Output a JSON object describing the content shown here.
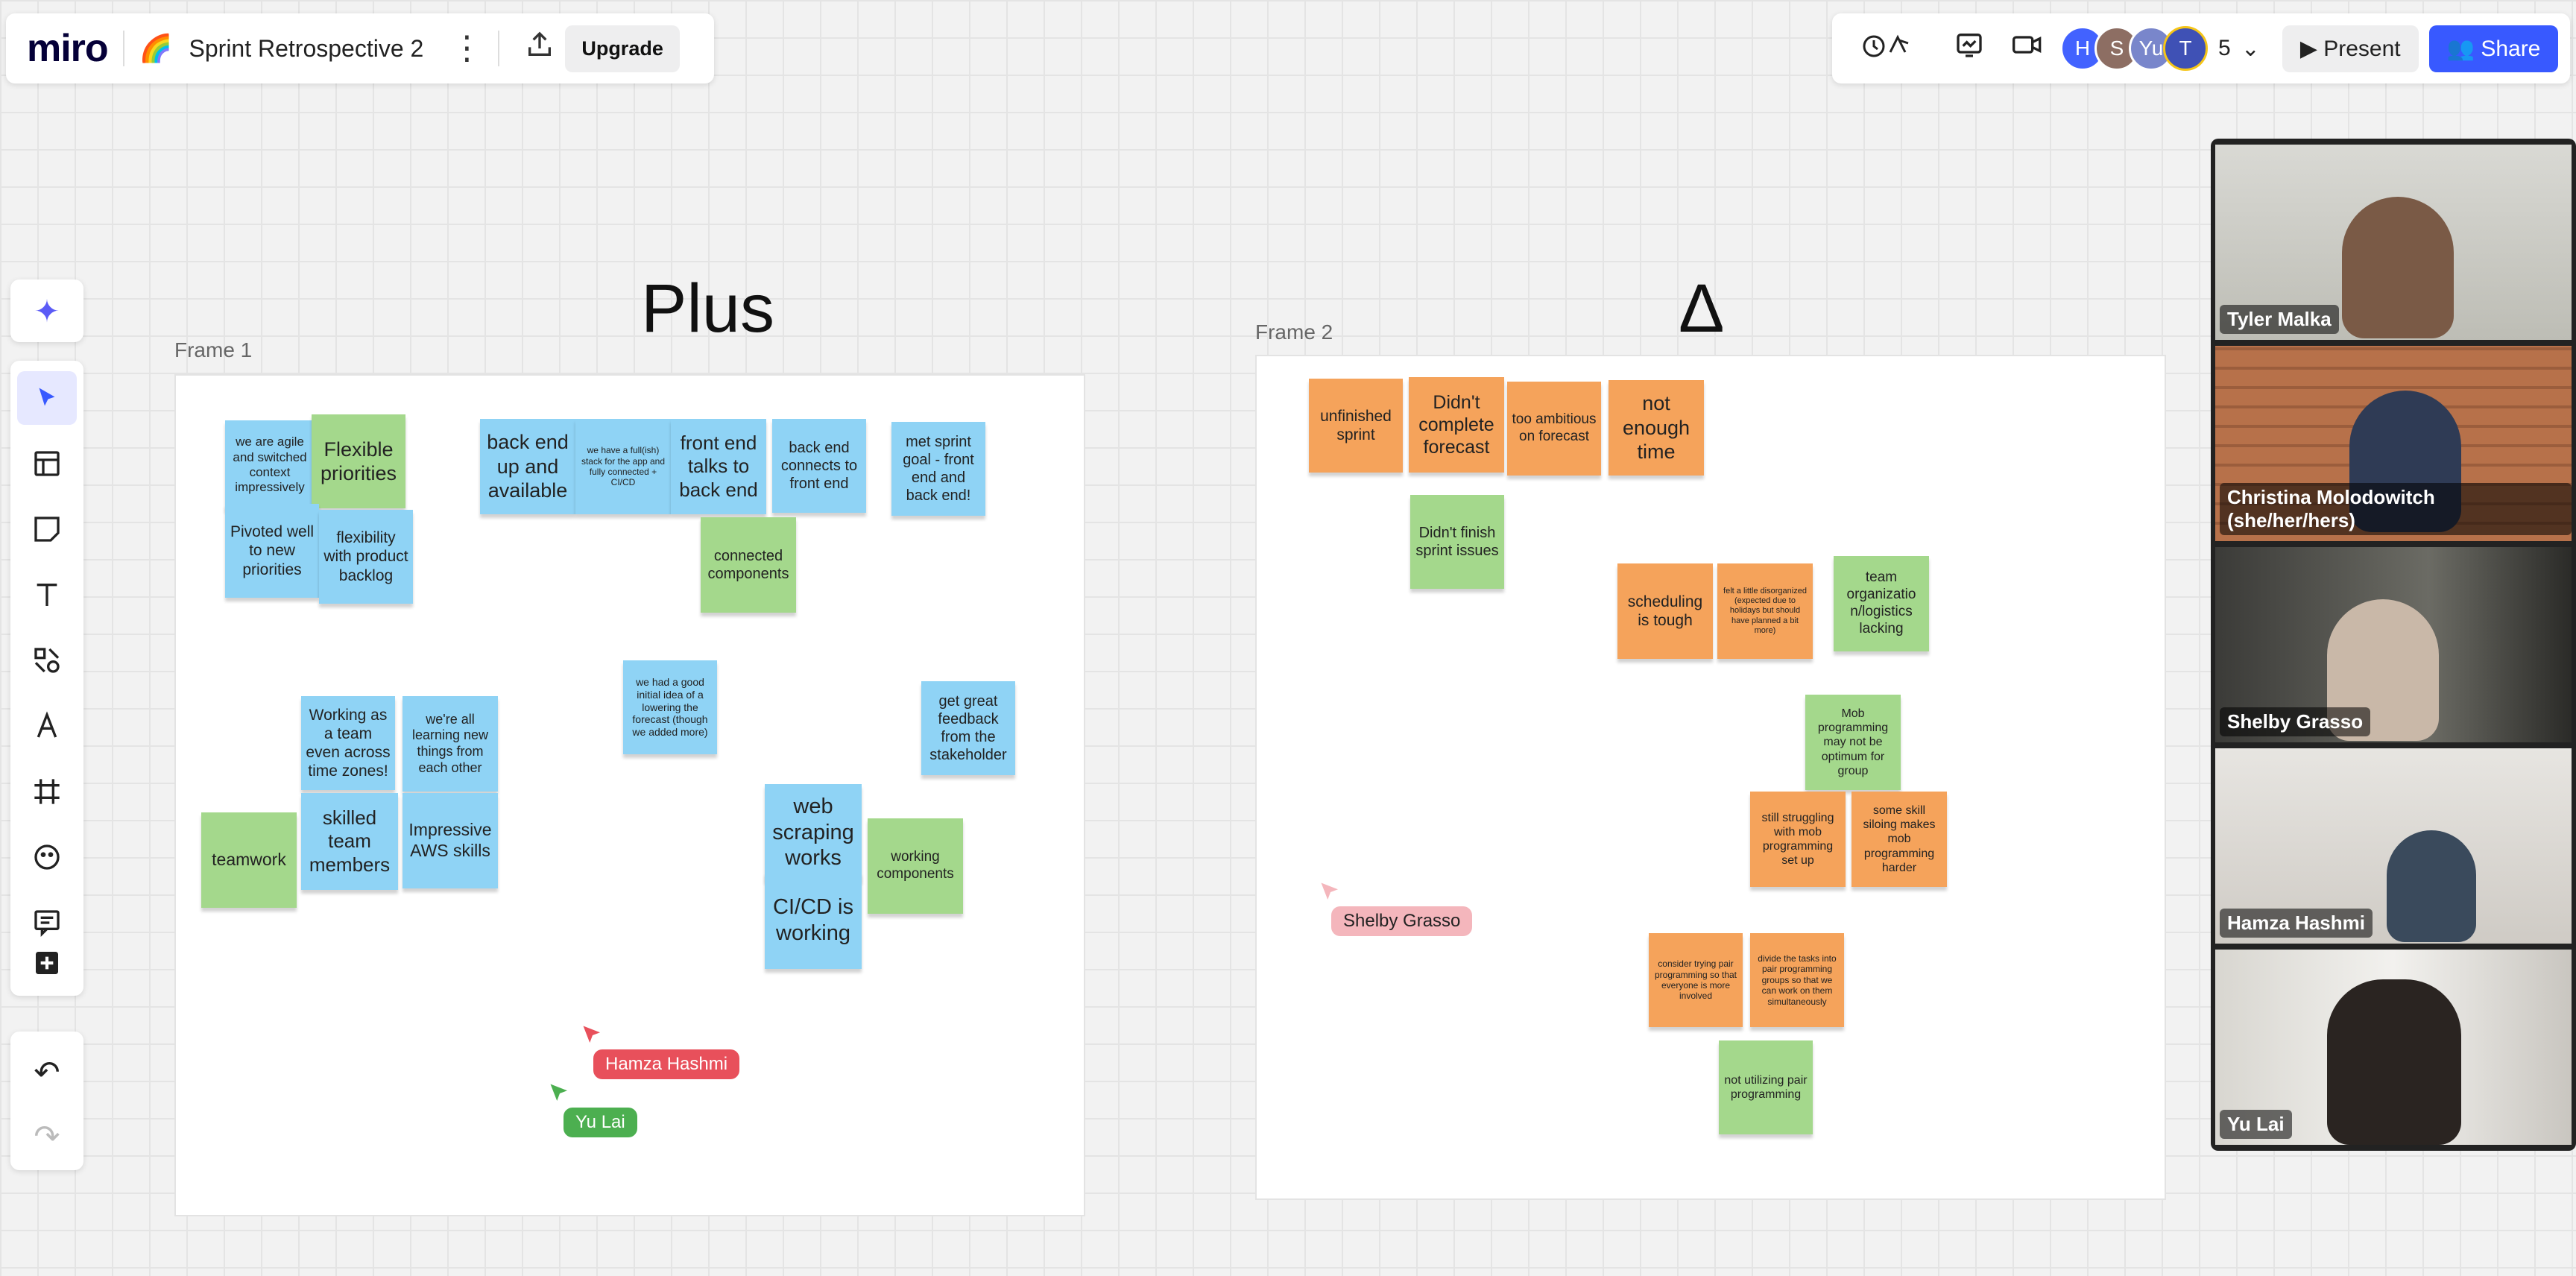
{
  "app": {
    "logo": "miro"
  },
  "board": {
    "emoji": "🌈",
    "title": "Sprint Retrospective 2",
    "menu_icon": "⋮",
    "upload_icon": "⇪",
    "upgrade_label": "Upgrade"
  },
  "topbar_right": {
    "reactions_icon": "♫",
    "timer_icon": "📈",
    "video_icon": "🎥",
    "avatars": [
      {
        "initial": "H",
        "color": "#4262ff"
      },
      {
        "initial": "S",
        "color": "#8d6e63"
      },
      {
        "initial": "Yu",
        "color": "#7986cb"
      },
      {
        "initial": "T",
        "color": "#3f51b5"
      }
    ],
    "collaborator_count": "5",
    "chevron": "⌄",
    "present_label": "▶  Present",
    "share_label": "👥 Share"
  },
  "toolbar": {
    "ai_icon": "✦",
    "tools": [
      "▲",
      "▦",
      "◳",
      "T",
      "◇",
      "Ʌ",
      "#",
      "☺",
      "☰",
      "+"
    ],
    "undo": "↶",
    "redo": "↷"
  },
  "frame1": {
    "label": "Frame 1",
    "heading": "Plus",
    "notes": [
      {
        "text": "we are agile and switched context impressively",
        "color": "blue"
      },
      {
        "text": "Flexible priorities",
        "color": "green"
      },
      {
        "text": "Pivoted well to new priorities",
        "color": "blue"
      },
      {
        "text": "flexibility with product backlog",
        "color": "blue"
      },
      {
        "text": "back end up and available",
        "color": "blue"
      },
      {
        "text": "we have a full(ish) stack for the app and fully connected + CI/CD",
        "color": "blue"
      },
      {
        "text": "front end talks to back end",
        "color": "blue"
      },
      {
        "text": "back end connects to front end",
        "color": "blue"
      },
      {
        "text": "met sprint goal - front end and back end!",
        "color": "blue"
      },
      {
        "text": "connected components",
        "color": "green"
      },
      {
        "text": "we had a good initial idea of a lowering the forecast (though we added more)",
        "color": "blue"
      },
      {
        "text": "get great feedback from the stakeholder",
        "color": "blue"
      },
      {
        "text": "Working as a team even across time zones!",
        "color": "blue"
      },
      {
        "text": "we're all learning new things from each other",
        "color": "blue"
      },
      {
        "text": "teamwork",
        "color": "green"
      },
      {
        "text": "skilled team members",
        "color": "blue"
      },
      {
        "text": "Impressive AWS skills",
        "color": "blue"
      },
      {
        "text": "web scraping works",
        "color": "blue"
      },
      {
        "text": "working components",
        "color": "green"
      },
      {
        "text": "CI/CD is working",
        "color": "blue"
      }
    ]
  },
  "frame2": {
    "label": "Frame 2",
    "heading": "Δ",
    "notes": [
      {
        "text": "unfinished sprint",
        "color": "orange"
      },
      {
        "text": "Didn't complete forecast",
        "color": "orange"
      },
      {
        "text": "too ambitious on forecast",
        "color": "orange"
      },
      {
        "text": "not enough time",
        "color": "orange"
      },
      {
        "text": "Didn't finish sprint issues",
        "color": "green"
      },
      {
        "text": "scheduling is tough",
        "color": "orange"
      },
      {
        "text": "felt a little disorganized (expected due to holidays but should have planned a bit more)",
        "color": "orange"
      },
      {
        "text": "team organizatio n/logistics lacking",
        "color": "green"
      },
      {
        "text": "Mob programming may not be optimum for group",
        "color": "green"
      },
      {
        "text": "still struggling with mob programming set up",
        "color": "orange"
      },
      {
        "text": "some skill siloing makes mob programming harder",
        "color": "orange"
      },
      {
        "text": "consider trying pair programming so that everyone is more involved",
        "color": "orange"
      },
      {
        "text": "divide the tasks into pair programming groups so that we can work on them simultaneously",
        "color": "orange"
      },
      {
        "text": "not utilizing pair programming",
        "color": "green"
      }
    ]
  },
  "cursors": [
    {
      "name": "Hamza Hashmi",
      "color": "#e8505b"
    },
    {
      "name": "Yu Lai",
      "color": "#4caf50"
    },
    {
      "name": "Shelby Grasso",
      "color": "#f4b6bc"
    }
  ],
  "video_participants": [
    {
      "name": "Tyler Malka"
    },
    {
      "name": "Christina Molodowitch (she/her/hers)"
    },
    {
      "name": "Shelby Grasso"
    },
    {
      "name": "Hamza Hashmi"
    },
    {
      "name": "Yu Lai"
    }
  ]
}
